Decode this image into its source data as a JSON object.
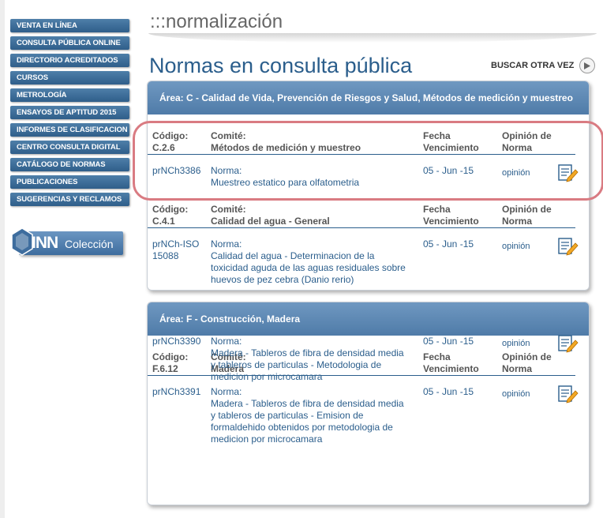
{
  "sidebar": {
    "items": [
      {
        "label": "VENTA EN LÍNEA"
      },
      {
        "label": "CONSULTA PÚBLICA ONLINE"
      },
      {
        "label": "DIRECTORIO ACREDITADOS"
      },
      {
        "label": "CURSOS"
      },
      {
        "label": "METROLOGÍA"
      },
      {
        "label": "ENSAYOS DE APTITUD 2015"
      },
      {
        "label": "INFORMES DE CLASIFICACION"
      },
      {
        "label": "CENTRO CONSULTA DIGITAL"
      },
      {
        "label": "CATÁLOGO DE NORMAS"
      },
      {
        "label": "PUBLICACIONES"
      },
      {
        "label": "SUGERENCIAS Y RECLAMOS"
      }
    ],
    "logo": {
      "brand": "INN",
      "sub": "Colección"
    }
  },
  "header": {
    "section": ":::normalización",
    "title": "Normas en consulta pública",
    "search_again": "BUSCAR OTRA VEZ"
  },
  "labels": {
    "codigo": "Código:",
    "comite": "Comité:",
    "fecha1": "Fecha",
    "fecha2": "Vencimiento",
    "opinion1": "Opinión de",
    "opinion2": "Norma",
    "norma": "Norma:",
    "opinion_link": "opinión"
  },
  "areas": [
    {
      "title": "Área: C - Calidad de Vida, Prevención de Riesgos y Salud, Métodos de medición y muestreo",
      "groups": [
        {
          "code": "C.2.6",
          "committee": "Métodos de medición y muestreo",
          "norms": [
            {
              "id": "prNCh3386",
              "id_lines": [
                "prNCh3386"
              ],
              "name_lines": [
                "Muestreo estatico para olfatometria"
              ],
              "date": "05 - Jun -15"
            }
          ]
        },
        {
          "code": "C.4.1",
          "committee": "Calidad del agua - General",
          "norms": [
            {
              "id": "prNCh-ISO 15088",
              "id_lines": [
                "prNCh-ISO",
                "15088"
              ],
              "name_lines": [
                "Calidad del agua - Determinacion de la",
                "toxicidad aguda de las aguas residuales sobre",
                "huevos de pez cebra (Danio rerio)"
              ],
              "date": "05 - Jun -15"
            }
          ]
        }
      ]
    },
    {
      "title": "Área: F - Construcción, Madera",
      "groups": [
        {
          "code": "F.6.12",
          "committee": "Madera",
          "norms": [
            {
              "id": "prNCh3391",
              "id_lines": [
                "prNCh3391"
              ],
              "name_lines": [
                "Madera - Tableros de fibra de densidad media",
                "y tableros de particulas - Emision de",
                "formaldehido obtenidos por metodologia de",
                "medicion por microcamara"
              ],
              "date": "05 - Jun -15"
            },
            {
              "id": "prNCh3390",
              "id_lines": [
                "prNCh3390"
              ],
              "name_lines": [
                "Madera - Tableros de fibra de densidad media",
                "y tableros de particulas - Metodologia de",
                "medicion por microcamara"
              ],
              "date": "05 - Jun -15"
            }
          ]
        }
      ]
    }
  ],
  "colors": {
    "accent": "#2b5e8c",
    "panel_header": "#5a86b2",
    "highlight": "#d97b82"
  }
}
